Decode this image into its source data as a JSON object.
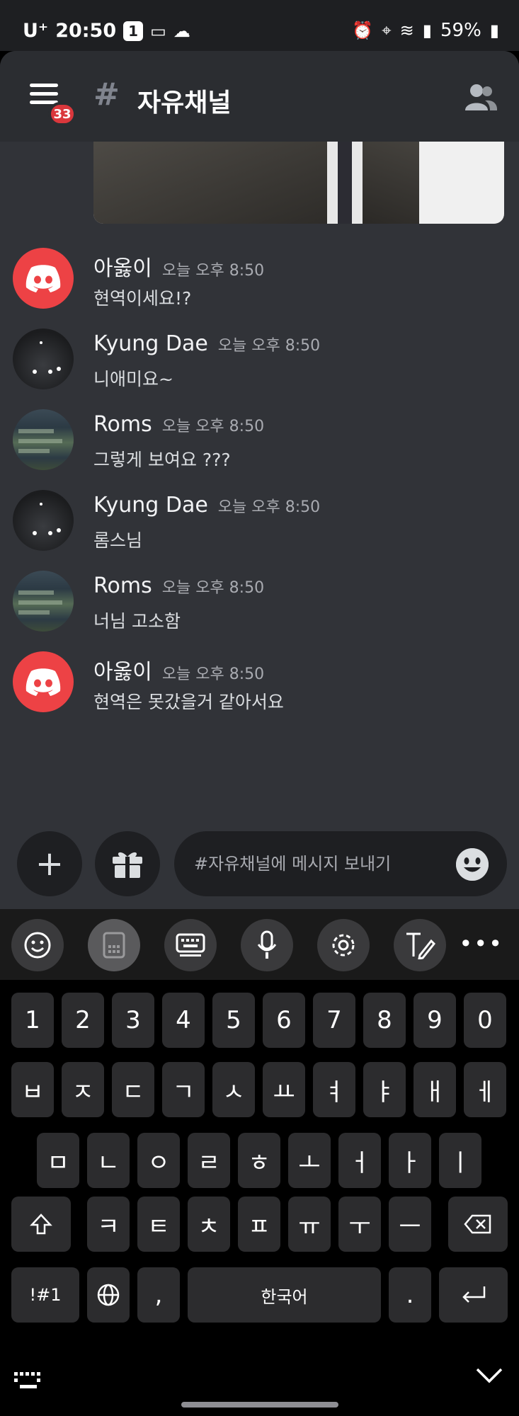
{
  "statusbar": {
    "carrier": "U⁺",
    "time": "20:50",
    "badge": "1",
    "battery": "59%"
  },
  "header": {
    "menu_badge": "33",
    "hash": "#",
    "channel": "자유채널"
  },
  "messages": [
    {
      "author": "아옳이",
      "time": "오늘 오후 8:50",
      "text": "현역이세요!?",
      "avatar": "discord"
    },
    {
      "author": "Kyung Dae",
      "time": "오늘 오후 8:50",
      "text": "니애미요~",
      "avatar": "kd"
    },
    {
      "author": "Roms",
      "time": "오늘 오후 8:50",
      "text": "그렇게 보여요 ???",
      "avatar": "roms"
    },
    {
      "author": "Kyung Dae",
      "time": "오늘 오후 8:50",
      "text": "롬스님",
      "avatar": "kd"
    },
    {
      "author": "Roms",
      "time": "오늘 오후 8:50",
      "text": "너님 고소함",
      "avatar": "roms"
    },
    {
      "author": "아옳이",
      "time": "오늘 오후 8:50",
      "text": "현역은 못갔을거 같아서요",
      "avatar": "discord"
    }
  ],
  "composer": {
    "plus": "+",
    "placeholder": "#자유채널에 메시지 보내기"
  },
  "keyboard": {
    "row1": [
      "1",
      "2",
      "3",
      "4",
      "5",
      "6",
      "7",
      "8",
      "9",
      "0"
    ],
    "row2": [
      "ㅂ",
      "ㅈ",
      "ㄷ",
      "ㄱ",
      "ㅅ",
      "ㅛ",
      "ㅕ",
      "ㅑ",
      "ㅐ",
      "ㅔ"
    ],
    "row3": [
      "ㅁ",
      "ㄴ",
      "ㅇ",
      "ㄹ",
      "ㅎ",
      "ㅗ",
      "ㅓ",
      "ㅏ",
      "ㅣ"
    ],
    "row4": [
      "ㅋ",
      "ㅌ",
      "ㅊ",
      "ㅍ",
      "ㅠ",
      "ㅜ",
      "ㅡ"
    ],
    "symbols": "!#1",
    "comma": ",",
    "space": "한국어",
    "period": ".",
    "more": "•••"
  },
  "icons": [
    "menu-icon",
    "members-icon",
    "gift-icon",
    "emoji-icon",
    "globe-icon",
    "shift-icon",
    "backspace-icon",
    "enter-icon",
    "mic-icon",
    "settings-icon",
    "keyboard-icon"
  ]
}
